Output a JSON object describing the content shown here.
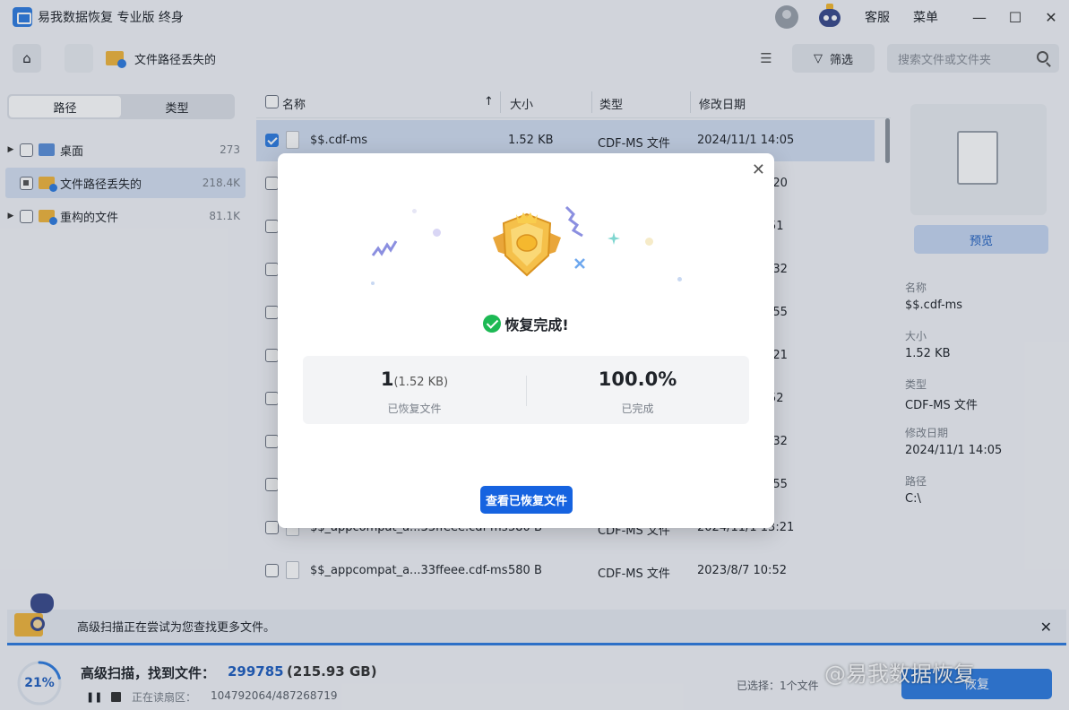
{
  "app": {
    "title": "易我数据恢复 专业版 终身"
  },
  "titlebar": {
    "support": "客服",
    "menu": "菜单",
    "minimize": "—",
    "maximize": "☐",
    "close": "✕"
  },
  "toolbar": {
    "path": "文件路径丢失的",
    "filter": "筛选",
    "search_placeholder": "搜索文件或文件夹"
  },
  "left": {
    "tabs": [
      "路径",
      "类型"
    ],
    "tree": [
      {
        "label": "桌面",
        "count": "273"
      },
      {
        "label": "文件路径丢失的",
        "count": "218.4K"
      },
      {
        "label": "重构的文件",
        "count": "81.1K"
      }
    ]
  },
  "table": {
    "headers": {
      "name": "名称",
      "size": "大小",
      "type": "类型",
      "date": "修改日期",
      "sort": "↑"
    },
    "rows": [
      {
        "name": "$$.cdf-ms",
        "size": "1.52 KB",
        "type": "CDF-MS 文件",
        "date": "2024/11/1 14:05"
      },
      {
        "name": "",
        "size": "",
        "type": "",
        "date": ":20"
      },
      {
        "name": "",
        "size": "",
        "type": "",
        "date": "51"
      },
      {
        "name": "",
        "size": "",
        "type": "",
        "date": ":32"
      },
      {
        "name": "",
        "size": "",
        "type": "",
        "date": ":55"
      },
      {
        "name": "",
        "size": "",
        "type": "",
        "date": ":21"
      },
      {
        "name": "",
        "size": "",
        "type": "",
        "date": "52"
      },
      {
        "name": "",
        "size": "",
        "type": "",
        "date": ":32"
      },
      {
        "name": "",
        "size": "",
        "type": "",
        "date": ":55"
      },
      {
        "name": "$$_appcompat_a...33ffeee.cdf-ms",
        "size": "580 B",
        "type": "CDF-MS 文件",
        "date": "2024/11/1 13:21"
      },
      {
        "name": "$$_appcompat_a...33ffeee.cdf-ms",
        "size": "580 B",
        "type": "CDF-MS 文件",
        "date": "2023/8/7 10:52"
      }
    ]
  },
  "details": {
    "preview": "预览",
    "name_label": "名称",
    "name": "$$.cdf-ms",
    "size_label": "大小",
    "size": "1.52 KB",
    "type_label": "类型",
    "type": "CDF-MS 文件",
    "date_label": "修改日期",
    "date": "2024/11/1 14:05",
    "path_label": "路径",
    "path": "C:\\"
  },
  "notice": {
    "text": "高级扫描正在尝试为您查找更多文件。",
    "close": "✕"
  },
  "status": {
    "progress_pct": "21%",
    "progress_value": 0.21,
    "title": "高级扫描，找到文件：",
    "count": "299785",
    "size": "(215.93 GB)",
    "reading_label": "正在读扇区：",
    "reading_value": "104792064/487268719",
    "selected": "已选择：1个文件",
    "recover": "恢复",
    "watermark": "@易我数据恢复"
  },
  "modal": {
    "close": "✕",
    "done": "恢复完成!",
    "recovered_count": "1",
    "recovered_size": "(1.52 KB)",
    "recovered_label": "已恢复文件",
    "percent": "100.0%",
    "percent_label": "已完成",
    "button": "查看已恢复文件"
  },
  "colors": {
    "accent": "#2f7de1",
    "button": "#1663e0",
    "success": "#1db954",
    "gold": "#f5b82e"
  }
}
